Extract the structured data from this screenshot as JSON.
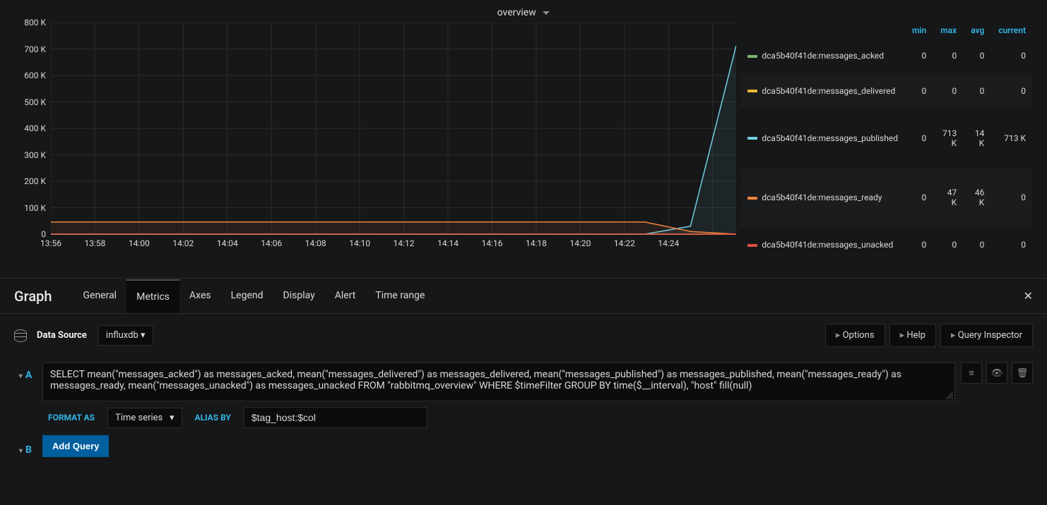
{
  "panel": {
    "title": "overview"
  },
  "chart_data": {
    "type": "line",
    "title": "overview",
    "xlabel": "",
    "ylabel": "",
    "ylim": [
      0,
      800000
    ],
    "y_ticks": [
      "0",
      "100 K",
      "200 K",
      "300 K",
      "400 K",
      "500 K",
      "600 K",
      "700 K",
      "800 K"
    ],
    "x_ticks": [
      "13:56",
      "13:58",
      "14:00",
      "14:02",
      "14:04",
      "14:06",
      "14:08",
      "14:10",
      "14:12",
      "14:14",
      "14:16",
      "14:18",
      "14:20",
      "14:22",
      "14:24"
    ],
    "series": [
      {
        "name": "dca5b40f41de:messages_acked",
        "color": "#7eb26d",
        "values": [
          0,
          0,
          0,
          0,
          0,
          0,
          0,
          0,
          0,
          0,
          0,
          0,
          0,
          0,
          0,
          0
        ]
      },
      {
        "name": "dca5b40f41de:messages_delivered",
        "color": "#eab839",
        "values": [
          0,
          0,
          0,
          0,
          0,
          0,
          0,
          0,
          0,
          0,
          0,
          0,
          0,
          0,
          0,
          0
        ]
      },
      {
        "name": "dca5b40f41de:messages_published",
        "color": "#6ed0e0",
        "values": [
          0,
          0,
          0,
          0,
          0,
          0,
          0,
          0,
          0,
          0,
          0,
          0,
          0,
          0,
          30000,
          713000
        ]
      },
      {
        "name": "dca5b40f41de:messages_ready",
        "color": "#ef843c",
        "values": [
          46000,
          46000,
          46000,
          46000,
          46000,
          46000,
          46000,
          46000,
          46000,
          46000,
          46000,
          46000,
          46000,
          46000,
          10000,
          0
        ]
      },
      {
        "name": "dca5b40f41de:messages_unacked",
        "color": "#e24d42",
        "values": [
          0,
          0,
          0,
          0,
          0,
          0,
          0,
          0,
          0,
          0,
          0,
          0,
          0,
          0,
          0,
          0
        ]
      }
    ]
  },
  "legend": {
    "cols": [
      "",
      "min",
      "max",
      "avg",
      "current"
    ],
    "rows": [
      {
        "color": "#7eb26d",
        "name": "dca5b40f41de:messages_acked",
        "min": "0",
        "max": "0",
        "avg": "0",
        "current": "0"
      },
      {
        "color": "#eab839",
        "name": "dca5b40f41de:messages_delivered",
        "min": "0",
        "max": "0",
        "avg": "0",
        "current": "0"
      },
      {
        "color": "#6ed0e0",
        "name": "dca5b40f41de:messages_published",
        "min": "0",
        "max": "713 K",
        "avg": "14 K",
        "current": "713 K"
      },
      {
        "color": "#ef843c",
        "name": "dca5b40f41de:messages_ready",
        "min": "0",
        "max": "47 K",
        "avg": "46 K",
        "current": "0"
      },
      {
        "color": "#e24d42",
        "name": "dca5b40f41de:messages_unacked",
        "min": "0",
        "max": "0",
        "avg": "0",
        "current": "0"
      }
    ]
  },
  "editor": {
    "title": "Graph",
    "tabs": [
      "General",
      "Metrics",
      "Axes",
      "Legend",
      "Display",
      "Alert",
      "Time range"
    ],
    "active_tab": "Metrics"
  },
  "datasource": {
    "label": "Data Source",
    "value": "influxdb"
  },
  "right_buttons": {
    "options": "Options",
    "help": "Help",
    "inspector": "Query Inspector"
  },
  "query": {
    "letter": "A",
    "sql": "SELECT mean(\"messages_acked\") as messages_acked, mean(\"messages_delivered\") as messages_delivered, mean(\"messages_published\") as messages_published, mean(\"messages_ready\") as messages_ready, mean(\"messages_unacked\") as messages_unacked FROM \"rabbitmq_overview\" WHERE $timeFilter GROUP BY time($__interval), \"host\" fill(null)",
    "format_label": "FORMAT AS",
    "format_value": "Time series",
    "alias_label": "ALIAS BY",
    "alias_value": "$tag_host:$col"
  },
  "query_b": {
    "letter": "B",
    "add_query": "Add Query"
  }
}
